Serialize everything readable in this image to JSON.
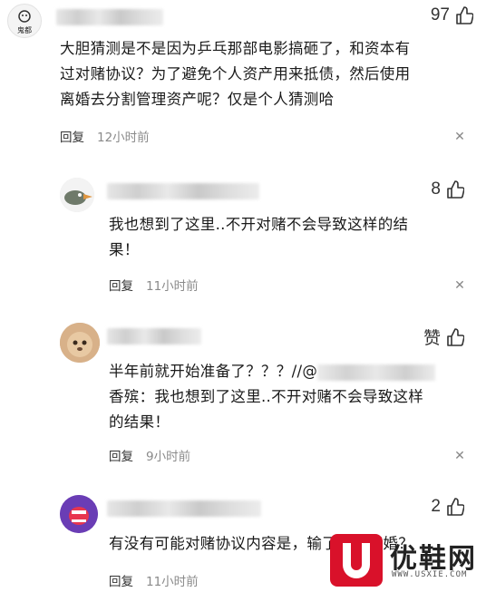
{
  "comments": [
    {
      "likes": "97",
      "text_lines": [
        "大胆猜测是不是因为乒乓那部电影搞砸了，和资本有",
        "过对赌协议？为了避免个人资产用来抵债，然后使用",
        "离婚去分割管理资产呢？仅是个人猜测哈"
      ],
      "reply_label": "回复",
      "time": "12小时前"
    },
    {
      "likes": "8",
      "text_lines": [
        "我也想到了这里..不开对赌不会导致这样的结",
        "果！"
      ],
      "reply_label": "回复",
      "time": "11小时前"
    },
    {
      "likes": "赞",
      "text_line1_prefix": "半年前就开始准备了？？？//@",
      "text_lines": [
        "香殡：我也想到了这里..不开对赌不会导致这样",
        "的结果！"
      ],
      "reply_label": "回复",
      "time": "9小时前"
    },
    {
      "likes": "2",
      "text_lines": [
        "有没有可能对赌协议内容是，输了两人离婚？"
      ],
      "reply_label": "回复",
      "time": "11小时前"
    }
  ],
  "avatar1_label": "鬼都",
  "watermark": {
    "brand": "优鞋网",
    "url": "WWW.USXIE.COM"
  },
  "colors": {
    "accent": "#d9112a",
    "meta": "#8a8a8a"
  }
}
